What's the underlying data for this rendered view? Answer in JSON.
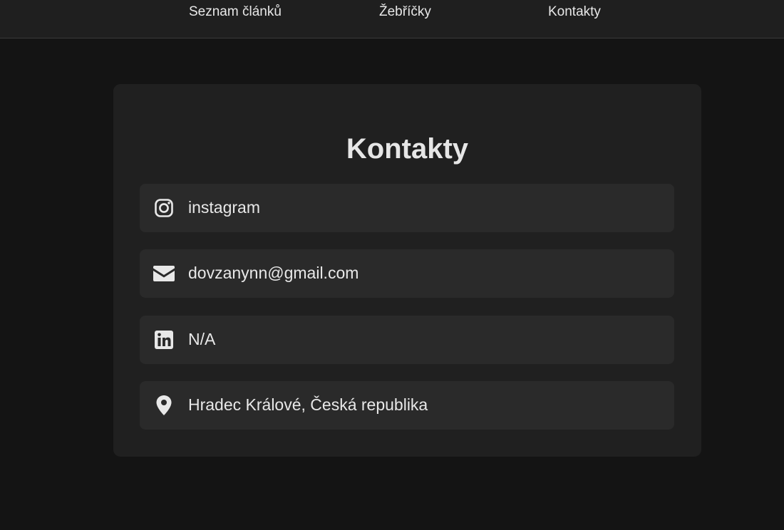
{
  "nav": {
    "items": [
      {
        "label": "Seznam článků"
      },
      {
        "label": "Žebříčky"
      },
      {
        "label": "Kontakty"
      }
    ]
  },
  "contacts": {
    "title": "Kontakty",
    "items": [
      {
        "icon": "instagram-icon",
        "text": "instagram"
      },
      {
        "icon": "envelope-icon",
        "text": "dovzanynn@gmail.com"
      },
      {
        "icon": "linkedin-icon",
        "text": "N/A"
      },
      {
        "icon": "location-pin-icon",
        "text": "Hradec Králové, Česká republika"
      }
    ]
  },
  "colors": {
    "page_bg": "#141414",
    "nav_bg": "#1f1f1f",
    "card_bg": "#202020",
    "row_bg": "#2a2a2a",
    "text": "#e6e6e6"
  }
}
